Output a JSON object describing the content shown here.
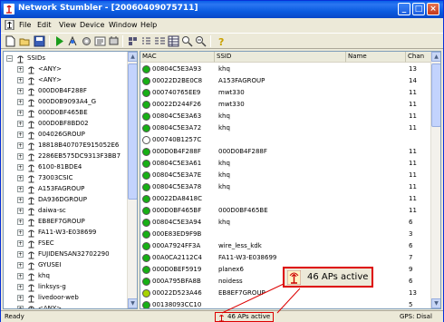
{
  "window": {
    "title": "Network Stumbler - [20060409075711]",
    "controls": [
      "minimize",
      "maximize",
      "close"
    ]
  },
  "menu": [
    "File",
    "Edit",
    "View",
    "Device",
    "Window",
    "Help"
  ],
  "toolbar": {
    "icons": [
      "new-icon",
      "open-icon",
      "save-icon",
      "play-icon",
      "scan-icon",
      "auto-config-icon",
      "properties-icon",
      "large-icons-icon",
      "small-icons-icon",
      "list-view-icon",
      "details-view-icon",
      "zoom-in-icon",
      "zoom-out-icon",
      "help-icon"
    ]
  },
  "tree": {
    "root": "SSIDs",
    "items": [
      "<ANY>",
      "<ANY>",
      "000D0B4F288F",
      "000D0B9093A4_G",
      "000D0BF465BE",
      "000D0BF8BD02",
      "004026GROUP",
      "18818B40707E915052E6",
      "2286EB575DC9313F3BB7",
      "6100-81BDE4",
      "73003CSIC",
      "A153FAGROUP",
      "DA936DGROUP",
      "daiwa-sc",
      "EB8EF7GROUP",
      "FA11-W3-E038699",
      "FSEC",
      "FUJIDENSAN32702290",
      "GYUSEI",
      "khq",
      "linksys-g",
      "livedoor-web",
      "<ANY>"
    ]
  },
  "list": {
    "columns": [
      "MAC",
      "SSID",
      "Name",
      "Chan"
    ],
    "rows": [
      {
        "mac": "00804C5E3A93",
        "ssid": "khq",
        "chan": "13",
        "status": "green"
      },
      {
        "mac": "00022D2BE0C8",
        "ssid": "A153FAGROUP",
        "chan": "14",
        "status": "green"
      },
      {
        "mac": "000740765EE9",
        "ssid": "mwt330",
        "chan": "11",
        "status": "green"
      },
      {
        "mac": "00022D244F26",
        "ssid": "mwt330",
        "chan": "11",
        "status": "green"
      },
      {
        "mac": "00804C5E3A63",
        "ssid": "khq",
        "chan": "11",
        "status": "green"
      },
      {
        "mac": "00804C5E3A72",
        "ssid": "khq",
        "chan": "11",
        "status": "green"
      },
      {
        "mac": "000740B1257C",
        "ssid": "",
        "chan": "",
        "status": "white"
      },
      {
        "mac": "000D0B4F288F",
        "ssid": "000D0B4F288F",
        "chan": "11",
        "status": "green"
      },
      {
        "mac": "00804C5E3A61",
        "ssid": "khq",
        "chan": "11",
        "status": "green"
      },
      {
        "mac": "00804C5E3A7E",
        "ssid": "khq",
        "chan": "11",
        "status": "green"
      },
      {
        "mac": "00804C5E3A78",
        "ssid": "khq",
        "chan": "11",
        "status": "green"
      },
      {
        "mac": "00022DA8418C",
        "ssid": "",
        "chan": "11",
        "status": "green"
      },
      {
        "mac": "000D0BF465BF",
        "ssid": "000D0BF465BE",
        "chan": "11",
        "status": "green"
      },
      {
        "mac": "00804C5E3A94",
        "ssid": "khq",
        "chan": "6",
        "status": "green"
      },
      {
        "mac": "000E83ED9F9B",
        "ssid": "",
        "chan": "3",
        "status": "green"
      },
      {
        "mac": "000A7924FF3A",
        "ssid": "wire_less_kdk",
        "chan": "6",
        "status": "green"
      },
      {
        "mac": "00A0CA2112C4",
        "ssid": "FA11-W3-E038699",
        "chan": "7",
        "status": "green"
      },
      {
        "mac": "000D0BEF5919",
        "ssid": "planex6",
        "chan": "9",
        "status": "green"
      },
      {
        "mac": "000A795BFA8B",
        "ssid": "noidess",
        "chan": "6",
        "status": "green"
      },
      {
        "mac": "00022D523A46",
        "ssid": "EB8EF7GROUP",
        "chan": "13",
        "status": "yellow-green"
      },
      {
        "mac": "00138093CC10",
        "ssid": "",
        "chan": "5",
        "status": "green"
      }
    ]
  },
  "status": {
    "left": "Ready",
    "ap_count": "46 APs active",
    "right": "GPS: Disal"
  },
  "callout": {
    "text": "46 APs active"
  }
}
